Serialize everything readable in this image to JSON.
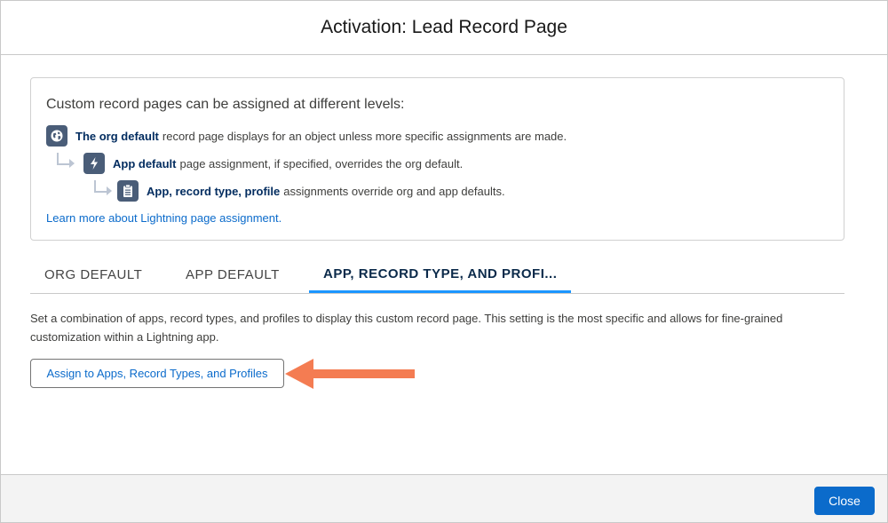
{
  "modal": {
    "title": "Activation: Lead Record Page"
  },
  "info": {
    "heading": "Custom record pages can be assigned at different levels:",
    "levels": [
      {
        "icon": "globe-icon",
        "bold": "The org default",
        "text": "record page displays for an object unless more specific assignments are made."
      },
      {
        "icon": "lightning-bolt-icon",
        "bold": "App default",
        "text": "page assignment, if specified, overrides the org default."
      },
      {
        "icon": "clipboard-icon",
        "bold": "App, record type, profile",
        "text": "assignments override org and app defaults."
      }
    ],
    "link": "Learn more about Lightning page assignment."
  },
  "tabs": [
    {
      "label": "ORG DEFAULT",
      "active": false
    },
    {
      "label": "APP DEFAULT",
      "active": false
    },
    {
      "label": "APP, RECORD TYPE, AND PROFI...",
      "active": true
    }
  ],
  "content": {
    "description": "Set a combination of apps, record types, and profiles to display this custom record page. This setting is the most specific and allows for fine-grained customization within a Lightning app.",
    "assign_button": "Assign to Apps, Record Types, and Profiles"
  },
  "footer": {
    "close_button": "Close"
  },
  "colors": {
    "accent": "#0b6bcb",
    "active_tab_underline": "#1b96ff",
    "annotation_arrow": "#f47c52"
  }
}
